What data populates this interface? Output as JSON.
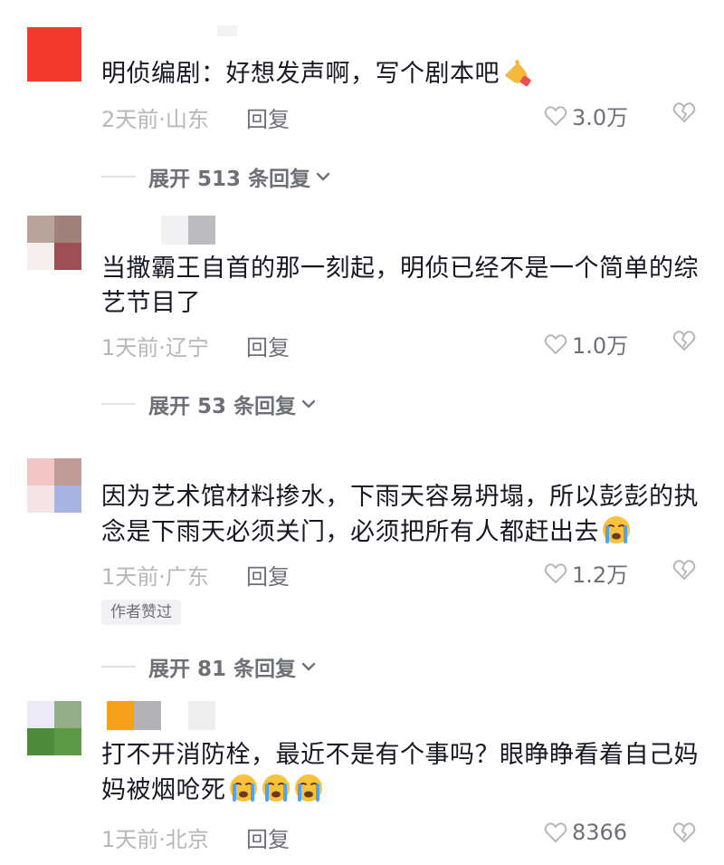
{
  "comments": [
    {
      "text": "明侦编剧：好想发声啊，写个剧本吧",
      "emoji": "pointing-hand-emoji",
      "time": "2天前·山东",
      "reply_label": "回复",
      "likes": "3.0万",
      "expand_label": "展开 513 条回复",
      "avatar_colors": [
        "#f23b2e"
      ]
    },
    {
      "text": "当撒霸王自首的那一刻起，明侦已经不是一个简单的综艺节目了",
      "time": "1天前·辽宁",
      "reply_label": "回复",
      "likes": "1.0万",
      "expand_label": "展开 53 条回复",
      "avatar_colors": [
        "#b8a49a",
        "#a1817b",
        "#f4eeec",
        "#9e4f55"
      ]
    },
    {
      "text": "因为艺术馆材料掺水，下雨天容易坍塌，所以彭彭的执念是下雨天必须关门，必须把所有人都赶出去",
      "emoji": "crying-face-emoji",
      "time": "1天前·广东",
      "reply_label": "回复",
      "likes": "1.2万",
      "author_liked": "作者赞过",
      "expand_label": "展开 81 条回复",
      "avatar_colors": [
        "#f0c5c3",
        "#c09c98",
        "#f5e4e6",
        "#a7b3e0"
      ]
    },
    {
      "text": "打不开消防栓，最近不是有个事吗？眼睁睁看着自己妈妈被烟呛死",
      "emoji_count": 3,
      "time": "1天前·北京",
      "reply_label": "回复",
      "likes": "8366",
      "avatar_colors": [
        "#eceaf6",
        "#93ad88",
        "#4d8a3a",
        "#5e9a45"
      ]
    }
  ],
  "colors": {
    "text": "#161823",
    "meta": "#b6b7bb",
    "secondary": "#6e7077",
    "divider": "#e3e3e5"
  }
}
